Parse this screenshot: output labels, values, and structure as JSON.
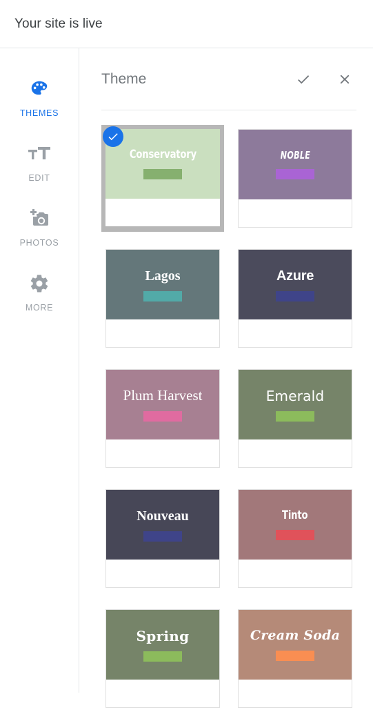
{
  "topbar": {
    "status_text": "Your site is live"
  },
  "sidebar": {
    "items": [
      {
        "label": "THEMES",
        "icon": "palette-icon",
        "active": true
      },
      {
        "label": "EDIT",
        "icon": "text-format-icon",
        "active": false
      },
      {
        "label": "PHOTOS",
        "icon": "add-photo-icon",
        "active": false
      },
      {
        "label": "MORE",
        "icon": "gear-icon",
        "active": false
      }
    ],
    "active_color": "#1a73e8",
    "inactive_color": "#9aa0a6"
  },
  "panel": {
    "title": "Theme",
    "confirm_label": "Done",
    "close_label": "Close",
    "confirm_icon": "check-icon",
    "close_icon": "close-icon"
  },
  "themes": [
    {
      "name": "Conservatory",
      "header_color": "#cadfbf",
      "accent_color": "#86b06f",
      "font_class": "font-condensed-bold",
      "selected": true
    },
    {
      "name": "NOBLE",
      "header_color": "#8d7a9b",
      "accent_color": "#a964d4",
      "font_class": "font-condensed-bold-italic",
      "selected": false
    },
    {
      "name": "Lagos",
      "header_color": "#64777a",
      "accent_color": "#52aaa8",
      "font_class": "font-serif-bold",
      "selected": false
    },
    {
      "name": "Azure",
      "header_color": "#4b4b5c",
      "accent_color": "#3f4489",
      "font_class": "font-sans-bold",
      "selected": false
    },
    {
      "name": "Plum Harvest",
      "header_color": "#a78092",
      "accent_color": "#e06ba0",
      "font_class": "font-serif-regular",
      "selected": false
    },
    {
      "name": "Emerald",
      "header_color": "#768469",
      "accent_color": "#8cbb5c",
      "font_class": "font-sans-light",
      "selected": false
    },
    {
      "name": "Nouveau",
      "header_color": "#474757",
      "accent_color": "#3f4489",
      "font_class": "font-serif-bold",
      "selected": false
    },
    {
      "name": "Tinto",
      "header_color": "#a2787a",
      "accent_color": "#e0525a",
      "font_class": "font-condensed-bold",
      "selected": false
    },
    {
      "name": "Spring",
      "header_color": "#768469",
      "accent_color": "#8cbb5c",
      "font_class": "font-slab-bold",
      "selected": false
    },
    {
      "name": "Cream Soda",
      "header_color": "#b58a78",
      "accent_color": "#f98e52",
      "font_class": "font-slab-bold-italic",
      "selected": false
    }
  ]
}
